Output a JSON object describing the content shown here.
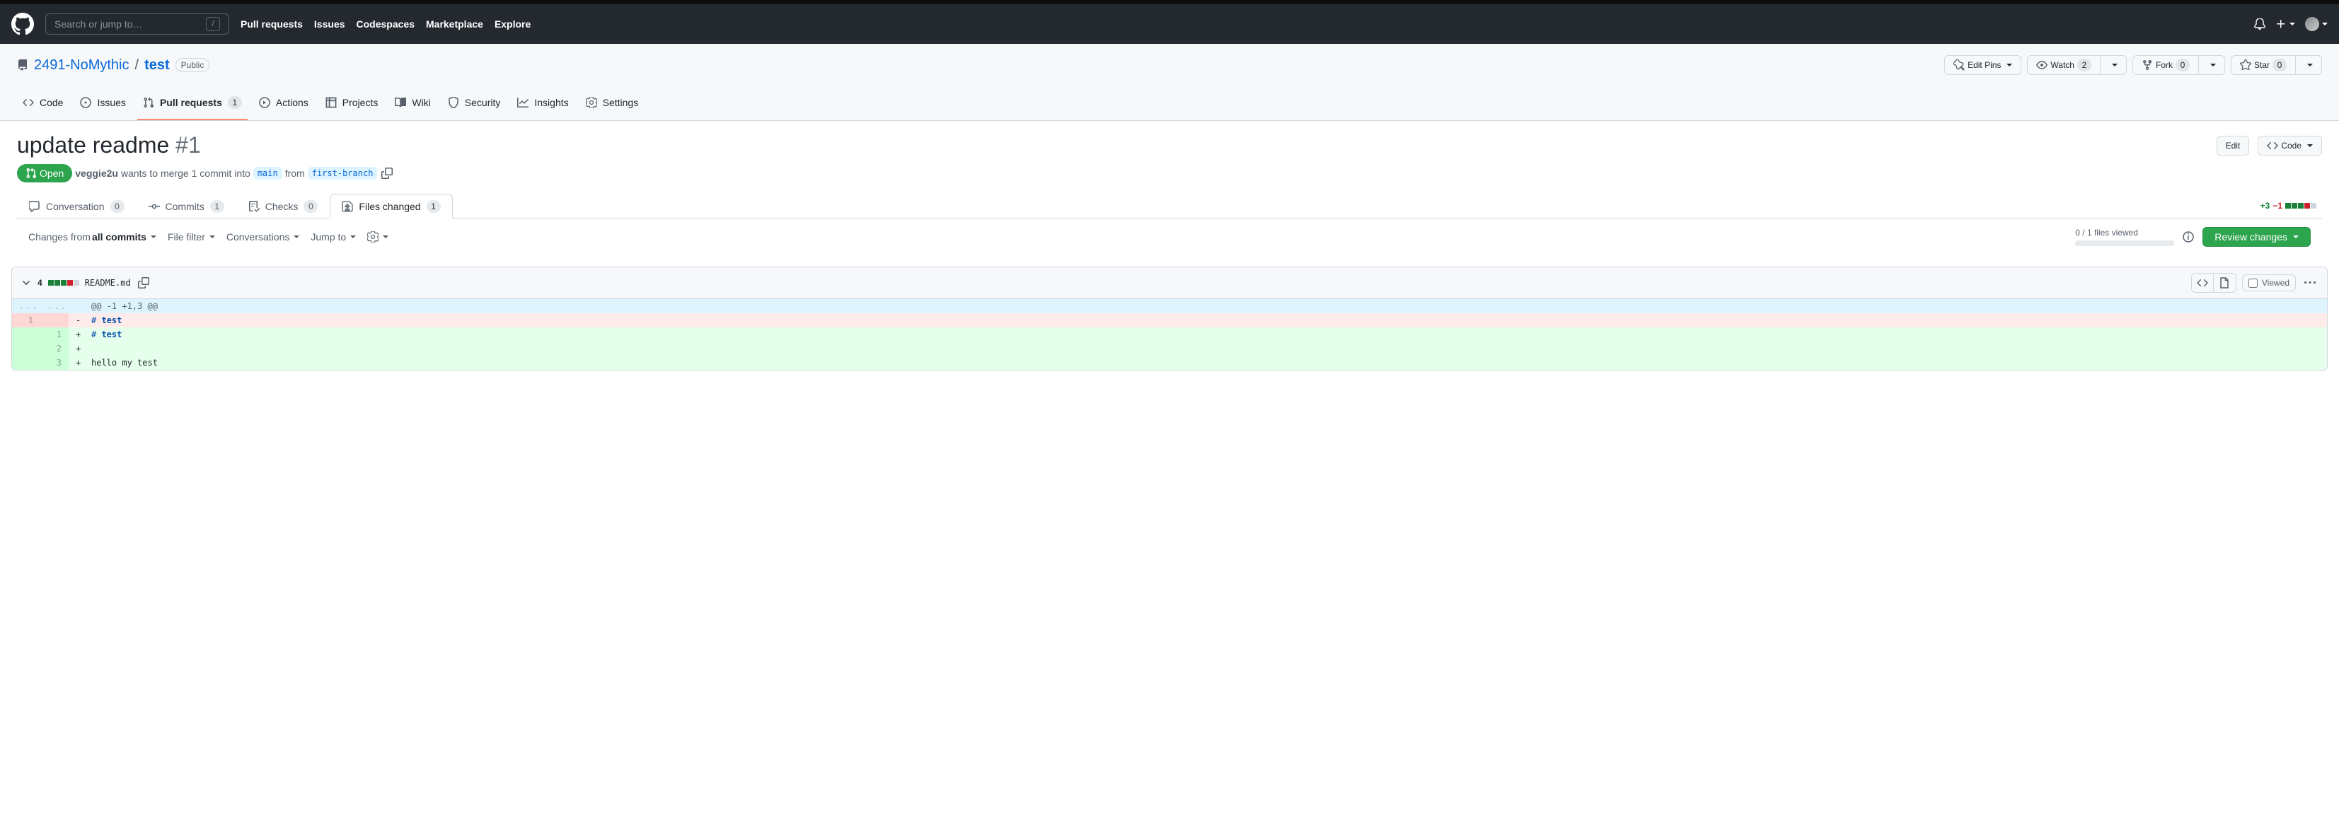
{
  "topnav": {
    "search_placeholder": "Search or jump to…",
    "slash": "/",
    "items": [
      "Pull requests",
      "Issues",
      "Codespaces",
      "Marketplace",
      "Explore"
    ]
  },
  "repo": {
    "owner": "2491-NoMythic",
    "name": "test",
    "visibility": "Public",
    "actions": {
      "edit_pins": "Edit Pins",
      "watch": "Watch",
      "watch_count": "2",
      "fork": "Fork",
      "fork_count": "0",
      "star": "Star",
      "star_count": "0"
    },
    "nav": [
      {
        "label": "Code"
      },
      {
        "label": "Issues"
      },
      {
        "label": "Pull requests",
        "count": "1",
        "active": true
      },
      {
        "label": "Actions"
      },
      {
        "label": "Projects"
      },
      {
        "label": "Wiki"
      },
      {
        "label": "Security"
      },
      {
        "label": "Insights"
      },
      {
        "label": "Settings"
      }
    ]
  },
  "pr": {
    "title": "update readme",
    "number": "#1",
    "state": "Open",
    "author": "veggie2u",
    "meta_prefix": " wants to merge 1 commit into ",
    "base_branch": "main",
    "meta_middle": " from ",
    "head_branch": "first-branch",
    "edit_btn": "Edit",
    "code_btn": "Code"
  },
  "tabs": {
    "conversation": {
      "label": "Conversation",
      "count": "0"
    },
    "commits": {
      "label": "Commits",
      "count": "1"
    },
    "checks": {
      "label": "Checks",
      "count": "0"
    },
    "files": {
      "label": "Files changed",
      "count": "1"
    }
  },
  "diffstat": {
    "additions": "+3",
    "deletions": "−1"
  },
  "toolbar": {
    "changes_prefix": "Changes from ",
    "changes_strong": "all commits",
    "file_filter": "File filter",
    "conversations": "Conversations",
    "jump_to": "Jump to",
    "files_viewed": "0 / 1 files viewed",
    "review_changes": "Review changes"
  },
  "file": {
    "change_count": "4",
    "name": "README.md",
    "viewed_label": "Viewed",
    "hunk": "@@ -1 +1,3 @@",
    "dots": "...",
    "lines": [
      {
        "old": "1",
        "new": "",
        "marker": "-",
        "type": "del",
        "content": "# test"
      },
      {
        "old": "",
        "new": "1",
        "marker": "+",
        "type": "add",
        "content": "# test"
      },
      {
        "old": "",
        "new": "2",
        "marker": "+",
        "type": "add",
        "content": ""
      },
      {
        "old": "",
        "new": "3",
        "marker": "+",
        "type": "add",
        "content": "hello my test"
      }
    ]
  }
}
